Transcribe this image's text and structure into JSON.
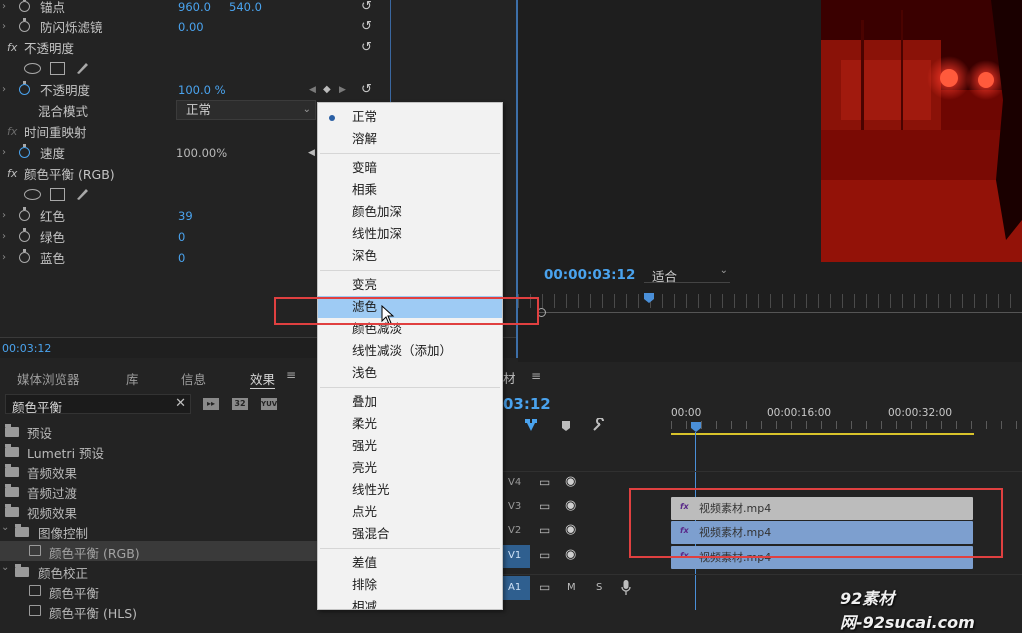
{
  "effect_controls": {
    "anchor_label": "锚点",
    "anchor_x": "960.0",
    "anchor_y": "540.0",
    "antiflicker_label": "防闪烁滤镜",
    "antiflicker_value": "0.00",
    "opacity_section": "不透明度",
    "opacity_label": "不透明度",
    "opacity_value": "100.0 %",
    "blend_mode_label": "混合模式",
    "blend_mode_value": "正常",
    "time_remap_section": "时间重映射",
    "speed_label": "速度",
    "speed_value": "100.00%",
    "color_balance_section": "颜色平衡 (RGB)",
    "red_label": "红色",
    "red_value": "39",
    "green_label": "绿色",
    "green_value": "0",
    "blue_label": "蓝色",
    "blue_value": "0",
    "timecode": "00:03:12"
  },
  "blend_menu": {
    "groups": [
      [
        "正常",
        "溶解"
      ],
      [
        "变暗",
        "相乘",
        "颜色加深",
        "线性加深",
        "深色"
      ],
      [
        "变亮",
        "滤色",
        "颜色减淡",
        "线性减淡（添加）",
        "浅色"
      ],
      [
        "叠加",
        "柔光",
        "强光",
        "亮光",
        "线性光",
        "点光",
        "强混合"
      ],
      [
        "差值",
        "排除",
        "相减"
      ]
    ],
    "selected": "正常",
    "highlighted": "滤色"
  },
  "effects_panel": {
    "tabs": [
      "媒体浏览器",
      "库",
      "信息",
      "效果"
    ],
    "active_tab": "效果",
    "search_value": "颜色平衡",
    "tree": [
      {
        "label": "预设",
        "level": 0,
        "type": "preset-folder"
      },
      {
        "label": "Lumetri 预设",
        "level": 0,
        "type": "preset-folder"
      },
      {
        "label": "音频效果",
        "level": 0,
        "type": "folder"
      },
      {
        "label": "音频过渡",
        "level": 0,
        "type": "folder"
      },
      {
        "label": "视频效果",
        "level": 0,
        "type": "folder"
      },
      {
        "label": "图像控制",
        "level": 1,
        "type": "folder"
      },
      {
        "label": "颜色平衡 (RGB)",
        "level": 2,
        "type": "effect"
      },
      {
        "label": "颜色校正",
        "level": 1,
        "type": "folder"
      },
      {
        "label": "颜色平衡",
        "level": 2,
        "type": "effect"
      },
      {
        "label": "颜色平衡 (HLS)",
        "level": 2,
        "type": "effect"
      }
    ]
  },
  "program_monitor": {
    "timecode": "00:00:03:12",
    "fit_label": "适合"
  },
  "timeline": {
    "tab_fragment": "材",
    "timecode_fragment": "03:12",
    "ruler": [
      "00:00",
      "00:00:16:00",
      "00:00:32:00"
    ],
    "tracks": [
      {
        "name": "V4"
      },
      {
        "name": "V3",
        "clip": "视频素材.mp4"
      },
      {
        "name": "V2",
        "clip": "视频素材.mp4"
      },
      {
        "name": "V1",
        "clip": "视频素材.mp4"
      },
      {
        "name": "A1",
        "m": "M",
        "s": "S"
      }
    ]
  },
  "watermark": "92素材网-92sucai.com",
  "colors": {
    "accent_blue": "#4aa3ee",
    "highlight": "#9ecbf4",
    "annotation_red": "#e04040",
    "clip_blue": "#7d9fcf"
  }
}
